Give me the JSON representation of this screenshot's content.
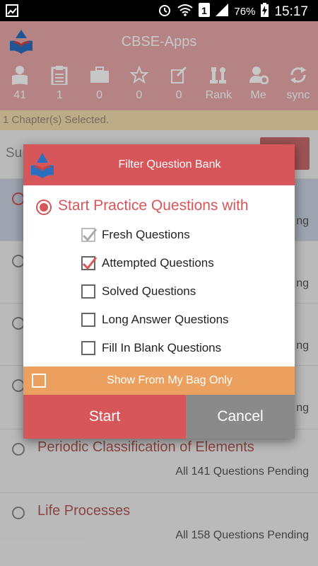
{
  "status_bar": {
    "battery": "76%",
    "time": "15:17",
    "icons": [
      "screenshot-icon",
      "alarm-icon",
      "wifi-icon",
      "sim-1-icon",
      "signal-icon",
      "battery-charging-icon"
    ]
  },
  "app_bar": {
    "title": "CBSE-Apps",
    "stats": [
      {
        "icon": "reader-icon",
        "label": "41"
      },
      {
        "icon": "clipboard-icon",
        "label": "1"
      },
      {
        "icon": "briefcase-icon",
        "label": "0"
      },
      {
        "icon": "star-icon",
        "label": "0"
      },
      {
        "icon": "edit-note-icon",
        "label": "0"
      },
      {
        "icon": "chess-pieces-icon",
        "label": "Rank"
      },
      {
        "icon": "user-settings-icon",
        "label": "Me"
      },
      {
        "icon": "sync-icon",
        "label": "sync"
      }
    ]
  },
  "chapter_banner": "1 Chapter(s) Selected.",
  "list": {
    "subject_label": "Su",
    "rows": [
      {
        "title": "",
        "pending": "ng",
        "selected": true
      },
      {
        "title": "",
        "pending": "ng",
        "selected": false
      },
      {
        "title": "",
        "pending": "ng",
        "selected": false
      },
      {
        "title": "",
        "pending": "ng",
        "selected": false
      },
      {
        "title": "Periodic Classification of Elements",
        "pending": "All 141 Questions Pending",
        "selected": false
      },
      {
        "title": "Life Processes",
        "pending": "All 158 Questions Pending",
        "selected": false
      }
    ]
  },
  "dialog": {
    "title": "Filter Question  Bank",
    "heading": "Start Practice Questions with",
    "options": [
      {
        "label": "Fresh Questions",
        "state": "checked-disabled"
      },
      {
        "label": "Attempted Questions",
        "state": "checked"
      },
      {
        "label": "Solved Questions",
        "state": "unchecked"
      },
      {
        "label": "Long Answer Questions",
        "state": "unchecked"
      },
      {
        "label": "Fill In Blank Questions",
        "state": "unchecked"
      }
    ],
    "bag_label": "Show From My Bag Only",
    "start_label": "Start",
    "cancel_label": "Cancel"
  },
  "colors": {
    "accent": "#d6565a",
    "appbar": "#e8a8a8",
    "banner": "#f1ddae",
    "bag_bar": "#eca05f",
    "cancel_btn": "#8a8a8a",
    "selected_row": "#c9d2e1"
  }
}
